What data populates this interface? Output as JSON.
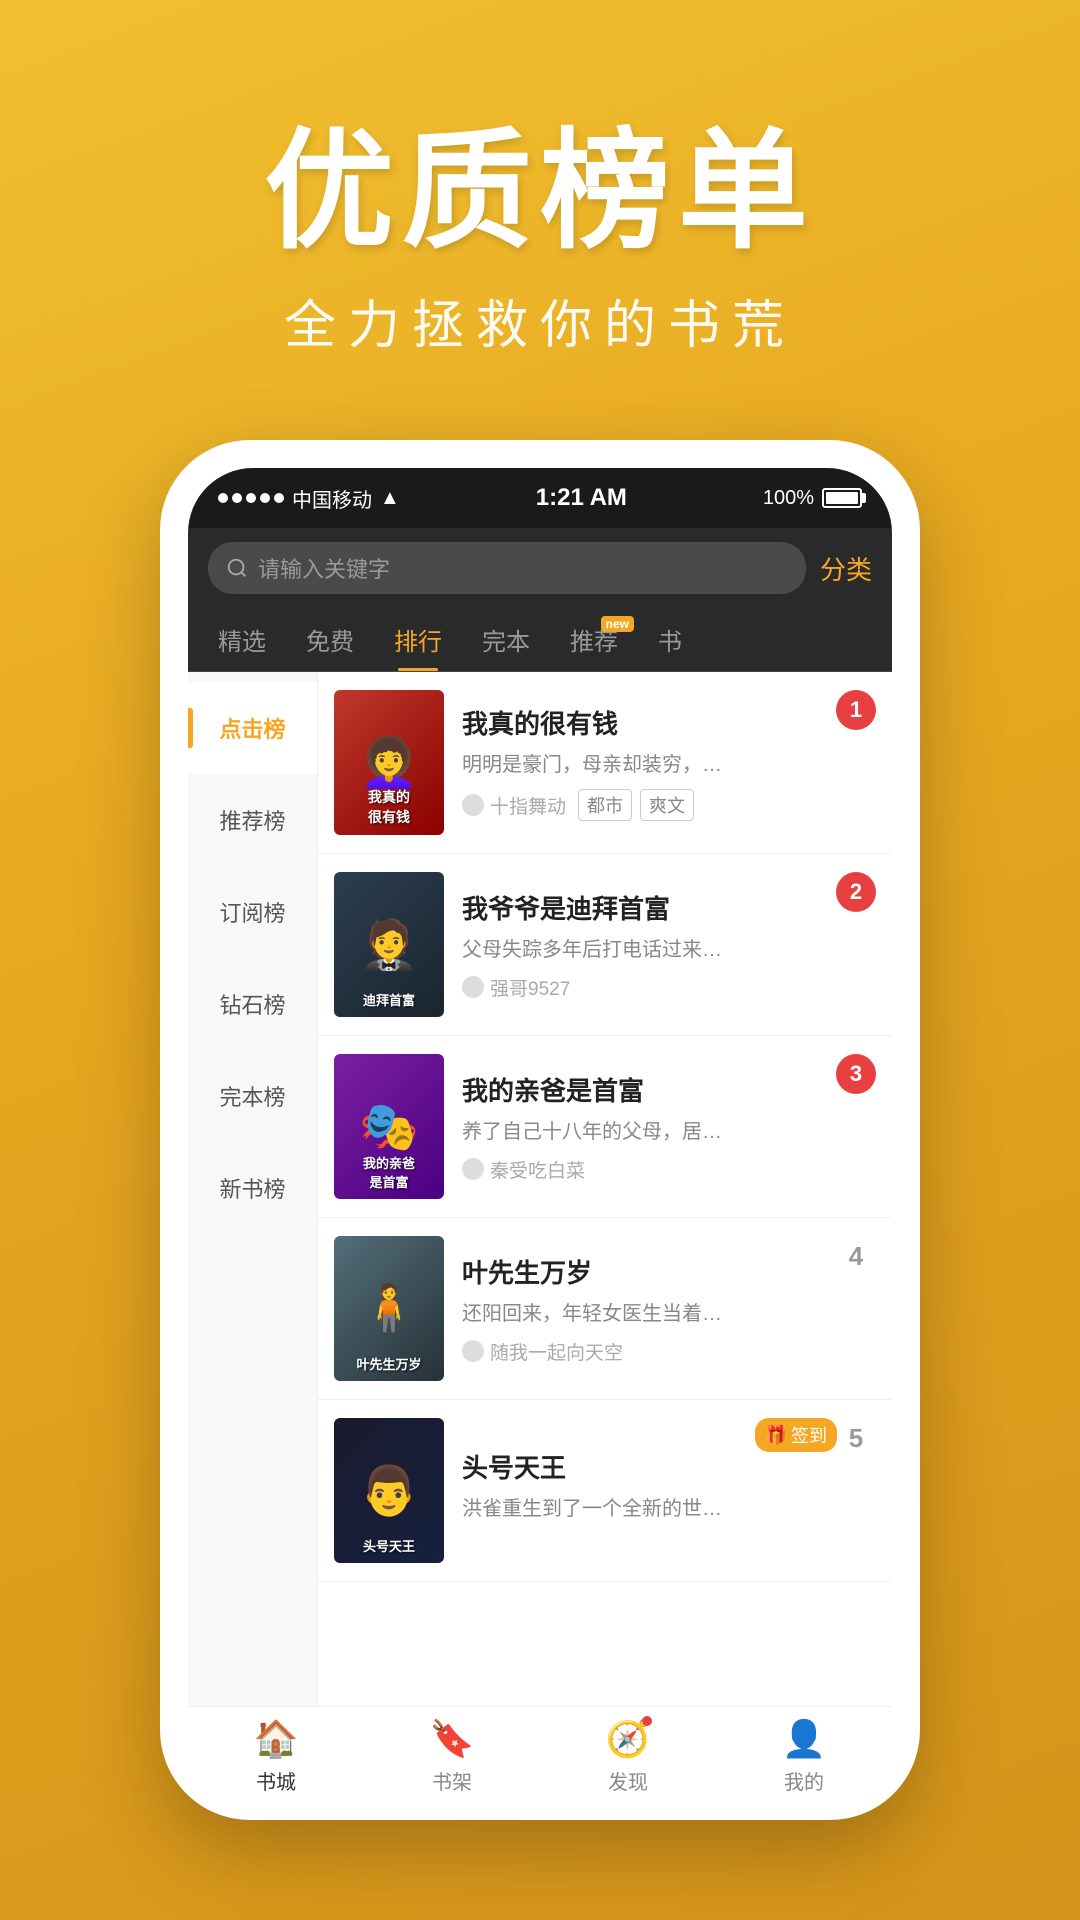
{
  "hero": {
    "title": "优质榜单",
    "subtitle": "全力拯救你的书荒"
  },
  "status_bar": {
    "carrier": "中国移动",
    "wifi": "📶",
    "time": "1:21 AM",
    "battery_pct": "100%"
  },
  "search": {
    "placeholder": "请输入关键字",
    "category_label": "分类"
  },
  "tabs": [
    {
      "label": "精选",
      "active": false,
      "has_new": false
    },
    {
      "label": "免费",
      "active": false,
      "has_new": false
    },
    {
      "label": "排行",
      "active": true,
      "has_new": false
    },
    {
      "label": "完本",
      "active": false,
      "has_new": false
    },
    {
      "label": "推荐",
      "active": false,
      "has_new": true
    },
    {
      "label": "书",
      "active": false,
      "has_new": false
    }
  ],
  "sidebar": [
    {
      "label": "点击榜",
      "active": true
    },
    {
      "label": "推荐榜",
      "active": false
    },
    {
      "label": "订阅榜",
      "active": false
    },
    {
      "label": "钻石榜",
      "active": false
    },
    {
      "label": "完本榜",
      "active": false
    },
    {
      "label": "新书榜",
      "active": false
    }
  ],
  "books": [
    {
      "rank": "1",
      "rank_type": "rank-1",
      "title": "我真的很有钱",
      "desc": "明明是豪门，母亲却装穷，…",
      "author": "十指舞动",
      "tags": [
        "都市",
        "爽文"
      ],
      "cover_class": "cover-1",
      "cover_text": "我真的很有钱",
      "cover_emoji": "👩"
    },
    {
      "rank": "2",
      "rank_type": "rank-2",
      "title": "我爷爷是迪拜首富",
      "desc": "父母失踪多年后打电话过来…",
      "author": "强哥9527",
      "tags": [],
      "cover_class": "cover-2",
      "cover_text": "迪拜首富",
      "cover_emoji": "🤵"
    },
    {
      "rank": "3",
      "rank_type": "rank-3",
      "title": "我的亲爸是首富",
      "desc": "养了自己十八年的父母，居…",
      "author": "秦受吃白菜",
      "tags": [],
      "cover_class": "cover-3",
      "cover_text": "我的亲爸",
      "cover_emoji": "🎭"
    },
    {
      "rank": "4",
      "rank_type": "rank-4",
      "title": "叶先生万岁",
      "desc": "还阳回来，年轻女医生当着…",
      "author": "随我一起向天空",
      "tags": [],
      "cover_class": "cover-4",
      "cover_text": "叶先生万岁",
      "cover_emoji": "🧍"
    },
    {
      "rank": "5",
      "rank_type": "rank-5",
      "title": "头号天王",
      "desc": "洪雀重生到了一个全新的世…",
      "author": "",
      "tags": [],
      "cover_class": "cover-5",
      "cover_text": "头号天王",
      "cover_emoji": "👨",
      "has_gift": true,
      "gift_label": "签到"
    }
  ],
  "bottom_nav": [
    {
      "label": "书城",
      "icon": "🏠",
      "active": true,
      "has_dot": false
    },
    {
      "label": "书架",
      "icon": "🔖",
      "active": false,
      "has_dot": false
    },
    {
      "label": "发现",
      "icon": "🧭",
      "active": false,
      "has_dot": true
    },
    {
      "label": "我的",
      "icon": "👤",
      "active": false,
      "has_dot": false
    }
  ]
}
